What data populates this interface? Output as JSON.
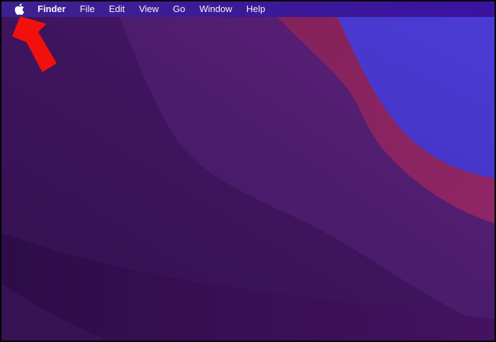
{
  "menu_bar": {
    "apple_icon": "apple-logo",
    "active_app": "Finder",
    "items": [
      "Finder",
      "File",
      "Edit",
      "View",
      "Go",
      "Window",
      "Help"
    ],
    "background_left": "#3E2190",
    "background_right": "#3A129F",
    "text_color": "#F7F5FA",
    "apple_logo_color": "#FFFFFF"
  },
  "annotation_arrow": {
    "color": "#F2100C",
    "points_to": "apple-menu"
  },
  "wallpaper": {
    "style": "macos-monterey-abstract-waves",
    "blue_top": "#4C3CD6",
    "blue_bottom": "#3C2CB4",
    "crimson_light": "#8F2566",
    "crimson_dark": "#7F2156",
    "band_light_start": "#3F1A63",
    "band_light_mid": "#4B1C6C",
    "band_light_end": "#66227D",
    "band_mid_start": "#33104F",
    "band_mid_end": "#49186A",
    "band_dark_start": "#2E0C49",
    "band_dark_end": "#431260",
    "corner_wedge": "#371254"
  }
}
